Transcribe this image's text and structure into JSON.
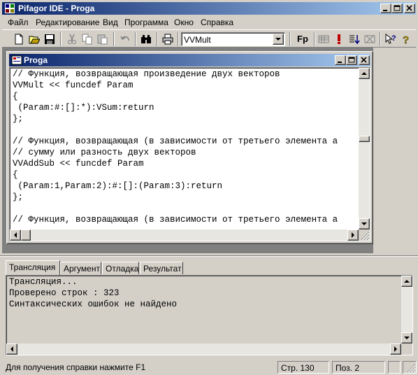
{
  "window": {
    "title": "Pifagor IDE - Proga"
  },
  "menu": [
    "Файл",
    "Редактирование",
    "Вид",
    "Программа",
    "Окно",
    "Справка"
  ],
  "toolbar": {
    "buttons": [
      "new-file",
      "open-folder",
      "save",
      "cut",
      "copy",
      "paste",
      "undo",
      "find",
      "print"
    ],
    "function_select": "VVMult",
    "fp_label": "Fp",
    "right_buttons": [
      "grid",
      "exclamation",
      "sort-down",
      "stop-grid",
      "help-cursor",
      "help"
    ]
  },
  "editor": {
    "title": "Proga",
    "lines": [
      "// Функция, возвращающая произведение двух векторов",
      "VVMult << funcdef Param",
      "{",
      " (Param:#:[]:*):VSum:return",
      "};",
      "",
      "// Функция, возвращающая (в зависимости от третьего элемента а",
      "// сумму или разность двух векторов",
      "VVAddSub << funcdef Param",
      "{",
      " (Param:1,Param:2):#:[]:(Param:3):return",
      "};",
      "",
      "// Функция, возвращающая (в зависимости от третьего элемента а",
      ""
    ]
  },
  "tabs": [
    "Трансляция",
    "Аргумент",
    "Отладка",
    "Результат"
  ],
  "output": {
    "lines": [
      "Трансляция...",
      "Проверено строк : 323",
      "Синтаксических ошибок не найдено"
    ]
  },
  "status": {
    "help": "Для получения справки нажмите F1",
    "line": "Стр. 130",
    "pos": "Поз. 2"
  },
  "colors": {
    "titlebar_start": "#0a246a",
    "titlebar_end": "#a6caf0",
    "mdi_bg": "#808080",
    "face": "#d4d0c8"
  }
}
